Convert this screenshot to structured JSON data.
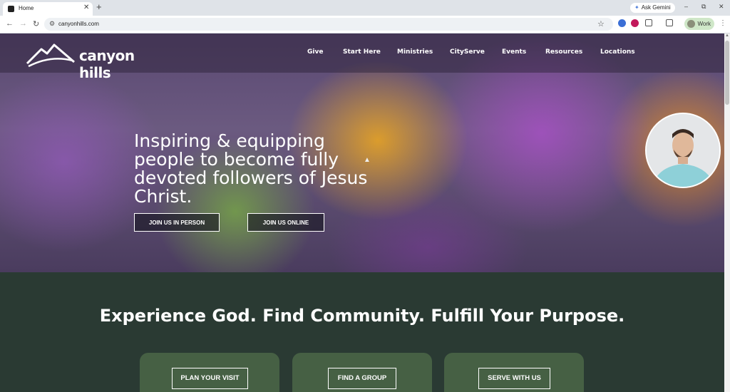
{
  "browser": {
    "tab_title": "Home",
    "tab_close": "✕",
    "new_tab": "+",
    "ask_gemini": "Ask Gemini",
    "url": "canyonhills.com",
    "profile_label": "Work",
    "win_min": "–",
    "win_max": "⧉",
    "win_close": "✕",
    "back": "←",
    "forward": "→",
    "reload": "↻",
    "star": "☆",
    "kebab": "⋮"
  },
  "site": {
    "logo_text": "canyon hills",
    "nav": [
      "Give",
      "Start Here",
      "Ministries",
      "CityServe",
      "Events",
      "Resources",
      "Locations"
    ],
    "hero": {
      "headline": "Inspiring & equipping people to become fully devoted followers of Jesus Christ.",
      "btn_in_person": "JOIN US IN PERSON",
      "btn_online": "JOIN US ONLINE"
    },
    "tagline": "Experience God. Find Community. Fulfill Your Purpose.",
    "cards": [
      "PLAN YOUR VISIT",
      "FIND A GROUP",
      "SERVE WITH US"
    ]
  },
  "colors": {
    "band_bg": "#2a3a33",
    "card_bg": "#466044",
    "profile_bg": "#cfe7c8"
  }
}
